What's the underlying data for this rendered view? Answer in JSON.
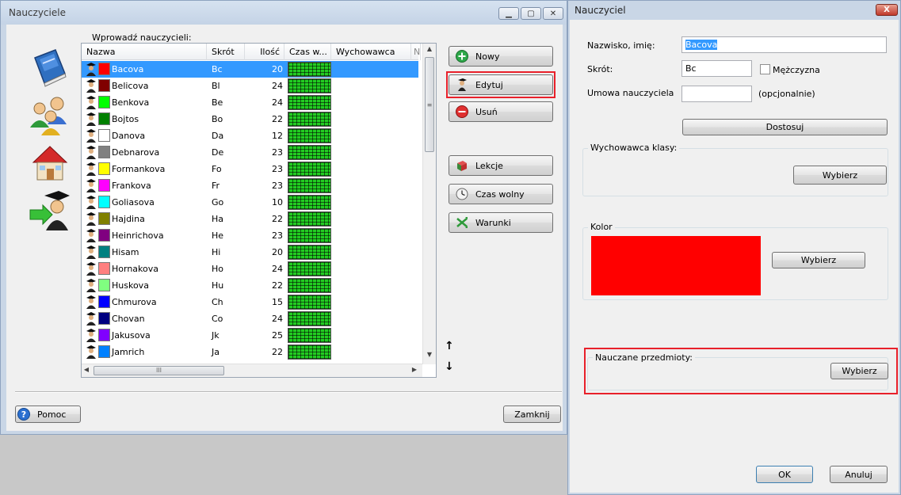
{
  "main_window": {
    "title": "Nauczyciele",
    "win_buttons": [
      "minimize",
      "maximize",
      "close"
    ]
  },
  "nav_icons": [
    "book-icon",
    "people-icon",
    "house-icon",
    "teacher-icon"
  ],
  "list": {
    "caption": "Wprowadź nauczycieli:",
    "columns": [
      "Nazwa",
      "Skrót",
      "Ilość",
      "Czas w...",
      "Wychowawca",
      "N"
    ],
    "rows": [
      {
        "name": "Bacova",
        "abbr": "Bc",
        "count": "20",
        "color": "#ff0000",
        "selected": true
      },
      {
        "name": "Belicova",
        "abbr": "Bl",
        "count": "24",
        "color": "#800000"
      },
      {
        "name": "Benkova",
        "abbr": "Be",
        "count": "24",
        "color": "#00ff00"
      },
      {
        "name": "Bojtos",
        "abbr": "Bo",
        "count": "22",
        "color": "#008000"
      },
      {
        "name": "Danova",
        "abbr": "Da",
        "count": "12",
        "color": "#ffffff"
      },
      {
        "name": "Debnarova",
        "abbr": "De",
        "count": "23",
        "color": "#808080"
      },
      {
        "name": "Formankova",
        "abbr": "Fo",
        "count": "23",
        "color": "#ffff00"
      },
      {
        "name": "Frankova",
        "abbr": "Fr",
        "count": "23",
        "color": "#ff00ff"
      },
      {
        "name": "Goliasova",
        "abbr": "Go",
        "count": "10",
        "color": "#00ffff"
      },
      {
        "name": "Hajdina",
        "abbr": "Ha",
        "count": "22",
        "color": "#808000"
      },
      {
        "name": "Heinrichova",
        "abbr": "He",
        "count": "23",
        "color": "#800080"
      },
      {
        "name": "Hisam",
        "abbr": "Hi",
        "count": "20",
        "color": "#008080"
      },
      {
        "name": "Hornakova",
        "abbr": "Ho",
        "count": "24",
        "color": "#ff8080"
      },
      {
        "name": "Huskova",
        "abbr": "Hu",
        "count": "22",
        "color": "#80ff80"
      },
      {
        "name": "Chmurova",
        "abbr": "Ch",
        "count": "15",
        "color": "#0000ff"
      },
      {
        "name": "Chovan",
        "abbr": "Co",
        "count": "24",
        "color": "#000080"
      },
      {
        "name": "Jakusova",
        "abbr": "Jk",
        "count": "25",
        "color": "#8000ff"
      },
      {
        "name": "Jamrich",
        "abbr": "Ja",
        "count": "22",
        "color": "#0080ff"
      }
    ]
  },
  "actions": {
    "new": "Nowy",
    "edit": "Edytuj",
    "delete": "Usuń",
    "lessons": "Lekcje",
    "free_time": "Czas wolny",
    "conditions": "Warunki"
  },
  "footer": {
    "help": "Pomoc",
    "close": "Zamknij"
  },
  "dialog": {
    "title": "Nauczyciel",
    "close_glyph": "X",
    "name_label": "Nazwisko, imię:",
    "name_value": "Bacova",
    "abbr_label": "Skrót:",
    "abbr_value": "Bc",
    "male_label": "Mężczyzna",
    "male_checked": false,
    "contract_label": "Umowa nauczyciela",
    "contract_value": "",
    "optional_label": "(opcjonalnie)",
    "customize": "Dostosuj",
    "class_teacher_group": "Wychowawca klasy:",
    "color_group": "Kolor",
    "color_value": "#ff0000",
    "subjects_group": "Nauczane przedmioty:",
    "choose": "Wybierz",
    "ok": "OK",
    "cancel": "Anuluj"
  }
}
